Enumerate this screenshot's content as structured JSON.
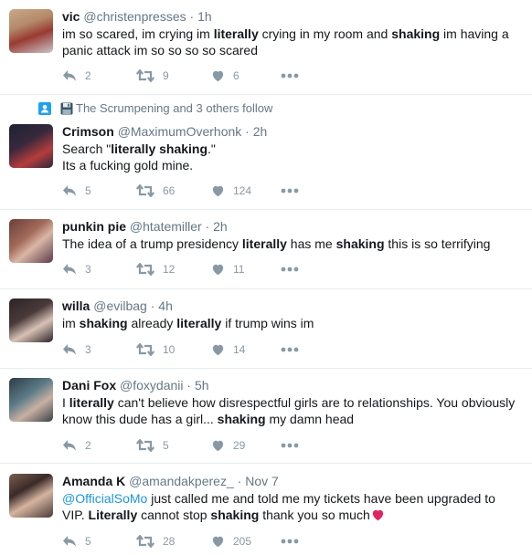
{
  "tweets": [
    {
      "name": "vic",
      "handle": "@christenpresses",
      "time": "1h",
      "lines": [
        [
          {
            "t": "im so scared, im crying im "
          },
          {
            "b": "literally"
          },
          {
            "t": " crying in my room and "
          },
          {
            "b": "shaking"
          },
          {
            "t": " im having a"
          }
        ],
        [
          {
            "t": "panic attack im so so so so scared"
          }
        ]
      ],
      "replies": "2",
      "retweets": "9",
      "likes": "6"
    },
    {
      "social": "The Scrumpening and 3 others follow",
      "name": "Crimson",
      "handle": "@MaximumOverhonk",
      "time": "2h",
      "lines": [
        [
          {
            "t": "Search \""
          },
          {
            "b": "literally shaking"
          },
          {
            "t": ".\""
          }
        ],
        [
          {
            "t": "Its a fucking gold mine."
          }
        ]
      ],
      "replies": "5",
      "retweets": "66",
      "likes": "124"
    },
    {
      "name": "punkin pie",
      "handle": "@htatemiller",
      "time": "2h",
      "lines": [
        [
          {
            "t": "The idea of a trump presidency "
          },
          {
            "b": "literally"
          },
          {
            "t": " has me "
          },
          {
            "b": "shaking"
          },
          {
            "t": " this is so terrifying"
          }
        ]
      ],
      "replies": "3",
      "retweets": "12",
      "likes": "11"
    },
    {
      "name": "willa",
      "handle": "@evilbag",
      "time": "4h",
      "lines": [
        [
          {
            "t": "im "
          },
          {
            "b": "shaking"
          },
          {
            "t": " already "
          },
          {
            "b": "literally"
          },
          {
            "t": " if trump wins im"
          }
        ]
      ],
      "replies": "3",
      "retweets": "10",
      "likes": "14"
    },
    {
      "name": "Dani Fox",
      "handle": "@foxydanii",
      "time": "5h",
      "lines": [
        [
          {
            "t": "I "
          },
          {
            "b": "literally"
          },
          {
            "t": " can't believe how disrespectful girls are to relationships. You obviously"
          }
        ],
        [
          {
            "t": "know this dude has a girl... "
          },
          {
            "b": "shaking"
          },
          {
            "t": " my damn head"
          }
        ]
      ],
      "replies": "2",
      "retweets": "5",
      "likes": "29"
    },
    {
      "name": "Amanda K",
      "handle": "@amandakperez_",
      "time": "Nov 7",
      "lines": [
        [
          {
            "m": "@OfficialSoMo"
          },
          {
            "t": " just called me and told me my tickets have been upgraded to"
          }
        ],
        [
          {
            "t": "VIP. "
          },
          {
            "b": "Literally"
          },
          {
            "t": " cannot stop "
          },
          {
            "b": "shaking"
          },
          {
            "t": " thank you so much"
          },
          {
            "e": "heart"
          }
        ]
      ],
      "replies": "5",
      "retweets": "28",
      "likes": "205"
    }
  ],
  "colors": {
    "icon": "#8899a6",
    "mention": "#1b95e0",
    "border": "#e6ecf0",
    "heart": "#e0245e"
  }
}
